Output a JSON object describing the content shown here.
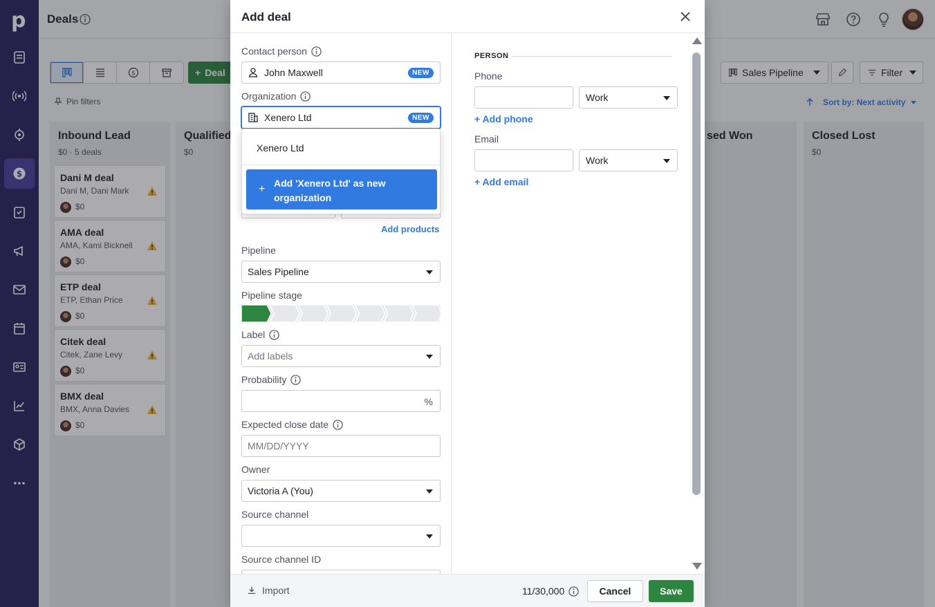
{
  "app": {
    "page_title": "Deals"
  },
  "colors": {
    "nav_bg": "#26235e",
    "nav_active": "#4a3d9b",
    "primary_blue": "#317ae2",
    "green": "#2e8540",
    "warning": "#f2b633"
  },
  "nav": {
    "logo": "p",
    "items": [
      "leads-icon",
      "broadcast-icon",
      "target-icon",
      "deals-icon",
      "tasks-icon",
      "campaigns-icon",
      "mail-icon",
      "calendar-icon",
      "contacts-icon",
      "insights-icon",
      "products-icon",
      "more-icon"
    ]
  },
  "toolbar": {
    "deal_button": "Deal",
    "pipeline": "Sales Pipeline",
    "filter": "Filter",
    "pin_filters": "Pin filters",
    "sort": "Sort by: Next activity"
  },
  "columns": [
    {
      "name": "Inbound Lead",
      "sub": "$0 · 5 deals"
    },
    {
      "name": "Qualified",
      "sub": "$0"
    },
    {
      "name": "sed Won",
      "sub": ""
    },
    {
      "name": "Closed Lost",
      "sub": "$0"
    }
  ],
  "cards": [
    {
      "title": "Dani M deal",
      "sub": "Dani M, Dani Mark",
      "value": "$0"
    },
    {
      "title": "AMA deal",
      "sub": "AMA, Kami Bicknell",
      "value": "$0"
    },
    {
      "title": "ETP deal",
      "sub": "ETP, Ethan Price",
      "value": "$0"
    },
    {
      "title": "Citek deal",
      "sub": "Citek, Zane Levy",
      "value": "$0"
    },
    {
      "title": "BMX deal",
      "sub": "BMX, Anna Davies",
      "value": "$0"
    }
  ],
  "modal": {
    "title": "Add deal",
    "contact_person": {
      "label": "Contact person",
      "value": "John Maxwell",
      "badge": "NEW"
    },
    "organization": {
      "label": "Organization",
      "value": "Xenero Ltd",
      "badge": "NEW"
    },
    "org_dropdown": {
      "match": "Xenero Ltd",
      "add_line1": "Add 'Xenero Ltd' as new",
      "add_line2": "organization"
    },
    "add_products": "Add products",
    "pipeline": {
      "label": "Pipeline",
      "value": "Sales Pipeline"
    },
    "pipeline_stage": {
      "label": "Pipeline stage",
      "total": 7,
      "active": 1
    },
    "label_field": {
      "label": "Label",
      "placeholder": "Add labels"
    },
    "probability": {
      "label": "Probability",
      "suffix": "%"
    },
    "close_date": {
      "label": "Expected close date",
      "placeholder": "MM/DD/YYYY"
    },
    "owner": {
      "label": "Owner",
      "value": "Victoria A (You)"
    },
    "source_channel": {
      "label": "Source channel",
      "value": ""
    },
    "source_channel_id": {
      "label": "Source channel ID"
    },
    "person": {
      "section": "PERSON",
      "phone_label": "Phone",
      "phone_type": "Work",
      "add_phone": "+ Add phone",
      "email_label": "Email",
      "email_type": "Work",
      "add_email": "+ Add email"
    },
    "footer": {
      "import": "Import",
      "count": "11/30,000",
      "cancel": "Cancel",
      "save": "Save"
    }
  }
}
